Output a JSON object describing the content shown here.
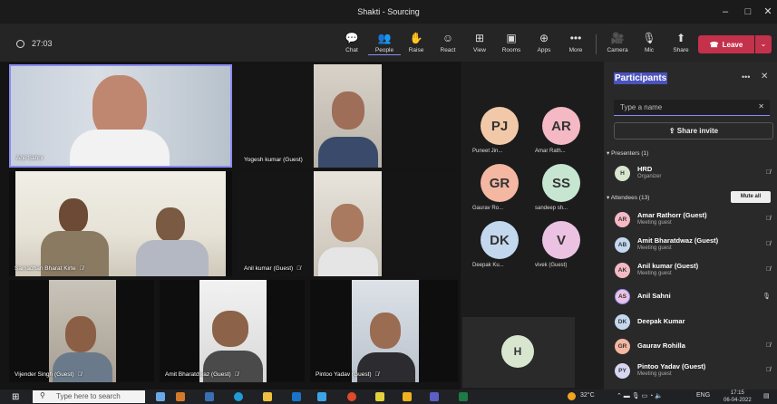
{
  "window": {
    "title": "Shakti - Sourcing"
  },
  "toolbar": {
    "timer": "27:03",
    "buttons": [
      {
        "label": "Chat",
        "icon": "chat-icon"
      },
      {
        "label": "People",
        "icon": "people-icon"
      },
      {
        "label": "Raise",
        "icon": "raise-hand-icon"
      },
      {
        "label": "React",
        "icon": "react-icon"
      },
      {
        "label": "View",
        "icon": "view-icon"
      },
      {
        "label": "Rooms",
        "icon": "rooms-icon"
      },
      {
        "label": "Apps",
        "icon": "apps-icon"
      },
      {
        "label": "More",
        "icon": "more-icon"
      },
      {
        "label": "Camera",
        "icon": "camera-off-icon"
      },
      {
        "label": "Mic",
        "icon": "mic-off-icon"
      },
      {
        "label": "Share",
        "icon": "share-icon"
      }
    ],
    "leave_label": "Leave"
  },
  "video_tiles": [
    {
      "name": "Anil Sahni"
    },
    {
      "name": "Yogesh kumar (Guest)"
    },
    {
      "name": "Samadhan Bharat Kirte"
    },
    {
      "name": "Anil kumar (Guest)"
    },
    {
      "name": "Vijender Singh (Guest)"
    },
    {
      "name": "Amit Bharatdwaz (Guest)"
    },
    {
      "name": "Pintoo Yadav (Guest)"
    }
  ],
  "avatar_tiles": [
    {
      "initials": "PJ",
      "name": "Puneet Jin...",
      "color": "#f2c9a8"
    },
    {
      "initials": "AR",
      "name": "Amar Rath...",
      "color": "#f4b9c5"
    },
    {
      "initials": "GR",
      "name": "Gaurav Ro...",
      "color": "#f3b7a2"
    },
    {
      "initials": "SS",
      "name": "sandeep sh...",
      "color": "#c6e6d2"
    },
    {
      "initials": "DK",
      "name": "Deepak Ku...",
      "color": "#c3d7ee"
    },
    {
      "initials": "V",
      "name": "vivek (Guest)",
      "color": "#ecc2e2"
    },
    {
      "initials": "H",
      "name": "",
      "color": "#d8e6cf"
    }
  ],
  "panel": {
    "title": "Participants",
    "search_placeholder": "Type a name",
    "share_invite": "Share invite",
    "presenters_header": "Presenters (1)",
    "attendees_header": "Attendees (13)",
    "mute_all": "Mute all",
    "presenters": [
      {
        "initials": "H",
        "name": "HRD",
        "role": "Organizer",
        "color": "#d8e6cf"
      }
    ],
    "attendees": [
      {
        "initials": "AR",
        "name": "Amar Rathorr (Guest)",
        "role": "Meeting guest",
        "color": "#f4b9c5"
      },
      {
        "initials": "AB",
        "name": "Amit Bharatdwaz (Guest)",
        "role": "Meeting guest",
        "color": "#c3d7ee"
      },
      {
        "initials": "AK",
        "name": "Anil kumar (Guest)",
        "role": "Meeting guest",
        "color": "#f4b9c5"
      },
      {
        "initials": "AS",
        "name": "Anil Sahni",
        "role": "",
        "color": "#ecc2e2"
      },
      {
        "initials": "DK",
        "name": "Deepak Kumar",
        "role": "",
        "color": "#c3d7ee"
      },
      {
        "initials": "GR",
        "name": "Gaurav Rohilla",
        "role": "",
        "color": "#f3b7a2"
      },
      {
        "initials": "PY",
        "name": "Pintoo Yadav (Guest)",
        "role": "Meeting guest",
        "color": "#d6d6f3"
      }
    ]
  },
  "taskbar": {
    "search_placeholder": "Type here to search",
    "temperature": "32°C",
    "language": "ENG",
    "time": "17:15",
    "date": "06-04-2022"
  }
}
